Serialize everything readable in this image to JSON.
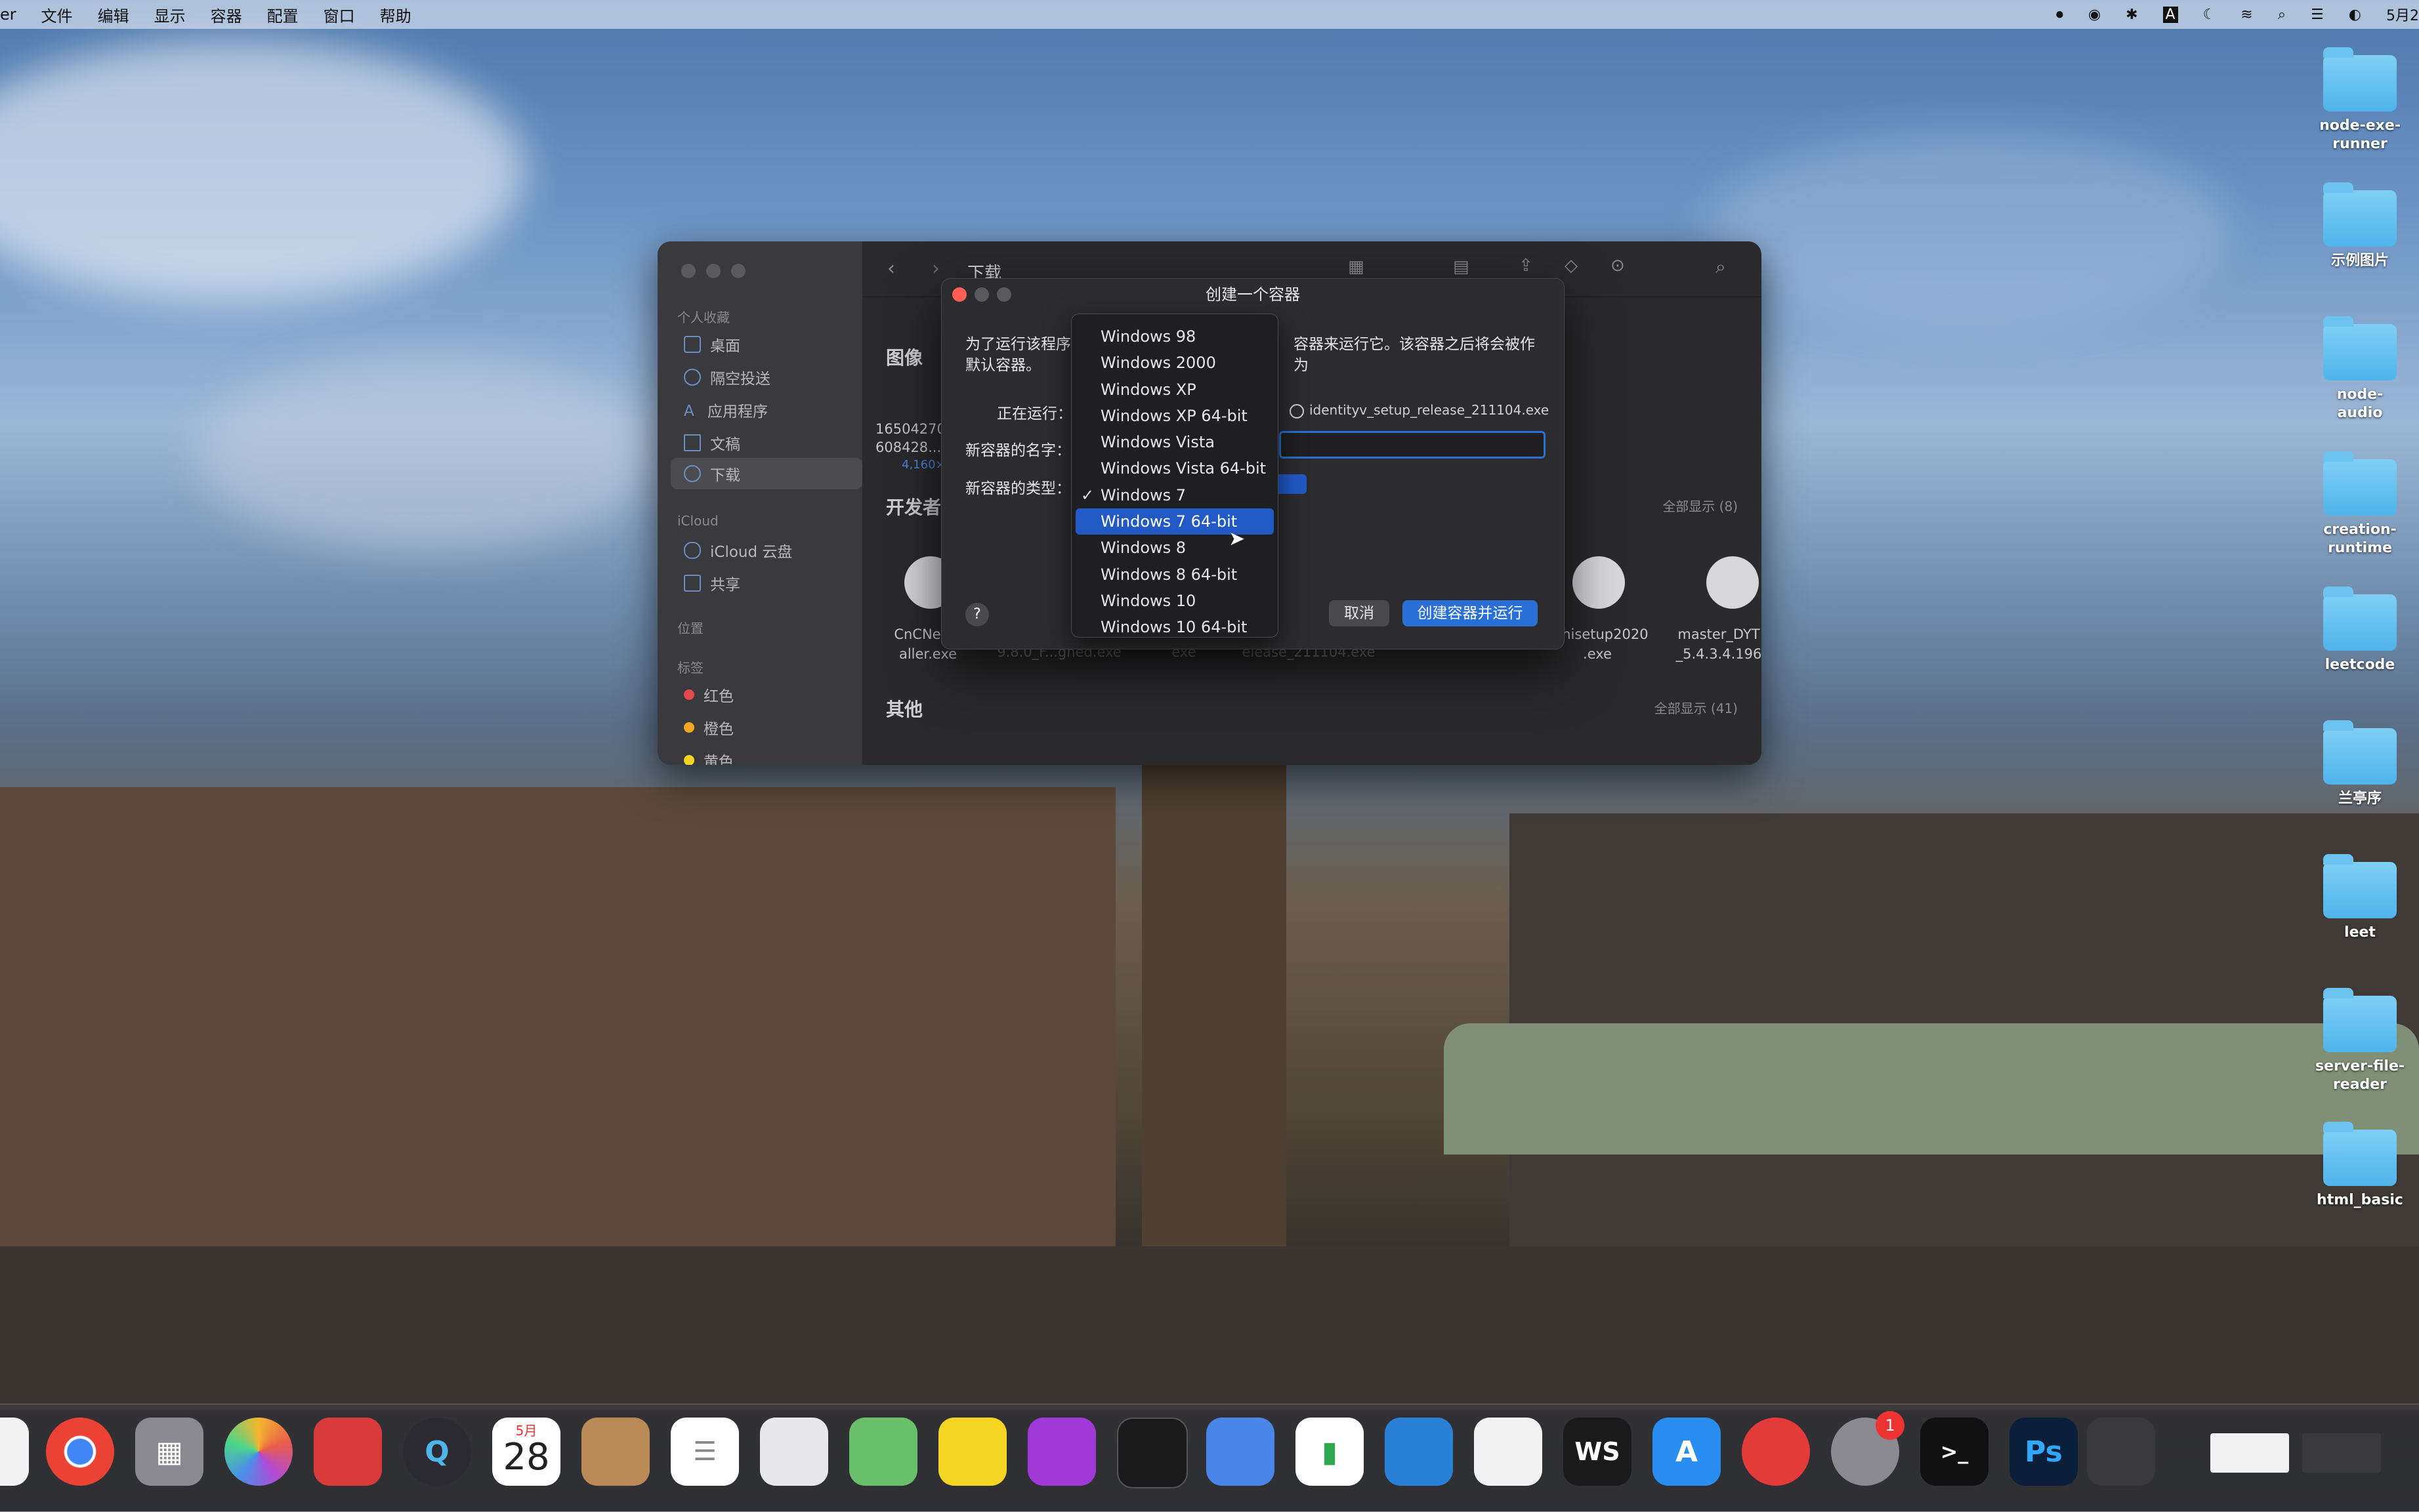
{
  "menubar": {
    "app_name": "er",
    "items": [
      "文件",
      "编辑",
      "显示",
      "容器",
      "配置",
      "窗口",
      "帮助"
    ],
    "date": "5月2"
  },
  "desktop_folders": [
    {
      "label": "node-exe-\nrunner"
    },
    {
      "label": "示例图片"
    },
    {
      "label": "node-audio"
    },
    {
      "label": "creation-\nruntime"
    },
    {
      "label": "leetcode"
    },
    {
      "label": "兰亭序"
    },
    {
      "label": "leet"
    },
    {
      "label": "server-file-\nreader"
    },
    {
      "label": "html_basic"
    }
  ],
  "finder": {
    "title": "下载",
    "sidebar": {
      "favorites_header": "个人收藏",
      "favorites": [
        "桌面",
        "隔空投送",
        "应用程序",
        "文稿",
        "下载"
      ],
      "icloud_header": "iCloud",
      "icloud": [
        "iCloud 云盘",
        "共享"
      ],
      "locations_header": "位置",
      "tags_header": "标签",
      "tags": [
        {
          "name": "红色",
          "color": "#e5484d"
        },
        {
          "name": "橙色",
          "color": "#f5a524"
        },
        {
          "name": "黄色",
          "color": "#f5d524"
        }
      ]
    },
    "sections": {
      "images": {
        "title": "图像",
        "file1": "16504270",
        "file1b": "608428...",
        "file1c": "4,160×"
      },
      "developer": {
        "title": "开发者",
        "show_all": "全部显示 (8)"
      },
      "other": {
        "title": "其他",
        "show_all": "全部显示 (41)"
      }
    },
    "files": [
      "CnCNet5_\naller.exe",
      "9.8.0_F...gned.exe",
      "exe",
      "elease_211104.exe",
      "ashisetup2020\n.exe",
      "master_DYT\n_5.4.3.4.196"
    ]
  },
  "dialog": {
    "title": "创建一个容器",
    "prompt_left": "为了运行该程序",
    "prompt_right": "容器来运行它。该容器之后将会被作为",
    "prompt_line2": "默认容器。",
    "running_label": "正在运行：",
    "running_file": "identityv_setup_release_211104.exe",
    "name_label": "新容器的名字：",
    "type_label": "新容器的类型：",
    "cancel": "取消",
    "create": "创建容器并运行",
    "help": "?"
  },
  "dropdown": {
    "options": [
      "Windows 98",
      "Windows 2000",
      "Windows XP",
      "Windows XP 64-bit",
      "Windows Vista",
      "Windows Vista 64-bit",
      "Windows 7",
      "Windows 7 64-bit",
      "Windows 8",
      "Windows 8 64-bit",
      "Windows 10",
      "Windows 10 64-bit"
    ],
    "checked": "Windows 7",
    "highlighted": "Windows 7 64-bit"
  },
  "dock": {
    "calendar_month": "5月",
    "calendar_day": "28",
    "settings_badge": "1"
  }
}
